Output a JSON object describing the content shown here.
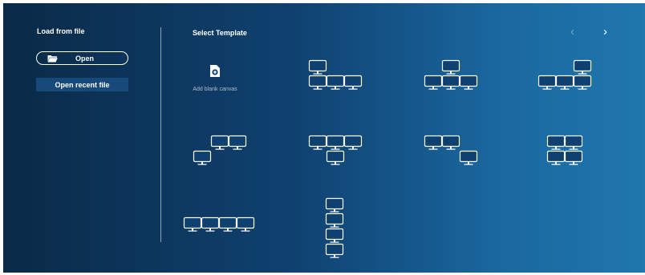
{
  "left": {
    "title": "Load from file",
    "open_label": "Open",
    "recent_label": "Open recent file",
    "open_icon": "folder-open-icon"
  },
  "main": {
    "title": "Select Template",
    "nav_prev": "‹",
    "nav_next": "›",
    "blank_canvas_label": "Add blank canvas",
    "blank_icon": "add-file-icon",
    "templates": [
      {
        "rows": 2,
        "cols": 3,
        "monitors": [
          [
            0,
            0
          ],
          [
            1,
            0
          ],
          [
            1,
            1
          ],
          [
            1,
            2
          ]
        ]
      },
      {
        "rows": 2,
        "cols": 3,
        "monitors": [
          [
            0,
            1
          ],
          [
            1,
            0
          ],
          [
            1,
            1
          ],
          [
            1,
            2
          ]
        ]
      },
      {
        "rows": 2,
        "cols": 3,
        "monitors": [
          [
            0,
            2
          ],
          [
            1,
            0
          ],
          [
            1,
            1
          ],
          [
            1,
            2
          ]
        ]
      },
      {
        "rows": 2,
        "cols": 3,
        "monitors": [
          [
            0,
            1
          ],
          [
            0,
            2
          ],
          [
            1,
            0
          ]
        ]
      },
      {
        "rows": 2,
        "cols": 3,
        "monitors": [
          [
            0,
            0
          ],
          [
            0,
            1
          ],
          [
            0,
            2
          ],
          [
            1,
            1
          ]
        ]
      },
      {
        "rows": 2,
        "cols": 3,
        "monitors": [
          [
            0,
            0
          ],
          [
            0,
            1
          ],
          [
            1,
            2
          ]
        ]
      },
      {
        "rows": 2,
        "cols": 2,
        "monitors": [
          [
            0,
            0
          ],
          [
            0,
            1
          ],
          [
            1,
            0
          ],
          [
            1,
            1
          ]
        ]
      },
      {
        "rows": 1,
        "cols": 4,
        "monitors": [
          [
            0,
            0
          ],
          [
            0,
            1
          ],
          [
            0,
            2
          ],
          [
            0,
            3
          ]
        ]
      },
      {
        "rows": 4,
        "cols": 1,
        "monitors": [
          [
            0,
            0
          ],
          [
            1,
            0
          ],
          [
            2,
            0
          ],
          [
            3,
            0
          ]
        ]
      }
    ]
  },
  "colors": {
    "monitor_fill": "#0f4170",
    "monitor_stroke": "#ffffff"
  }
}
